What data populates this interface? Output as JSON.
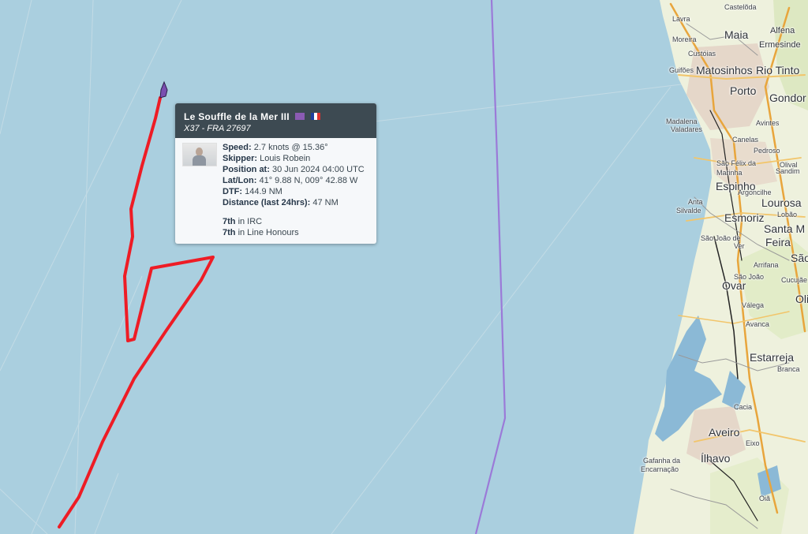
{
  "map": {
    "colors": {
      "sea": "#aacfdf",
      "land": "#eef0dd",
      "track": "#ee1c25",
      "course_line": "#9b7ad8",
      "boat": "#7a4fb0"
    },
    "places": [
      {
        "id": "castelo-da",
        "name": "Castelõda",
        "size": "small"
      },
      {
        "id": "lavra",
        "name": "Lavra",
        "size": "small"
      },
      {
        "id": "maia",
        "name": "Maia",
        "size": "big"
      },
      {
        "id": "alfena",
        "name": "Alfena",
        "size": "mid"
      },
      {
        "id": "moreira",
        "name": "Moreira",
        "size": "small"
      },
      {
        "id": "custoias",
        "name": "Custóias",
        "size": "small"
      },
      {
        "id": "ermesinde",
        "name": "Ermesinde",
        "size": "mid"
      },
      {
        "id": "guifoes",
        "name": "Guifões",
        "size": "small"
      },
      {
        "id": "matosinhos",
        "name": "Matosinhos",
        "size": "big"
      },
      {
        "id": "rio-tinto",
        "name": "Rio Tinto",
        "size": "big"
      },
      {
        "id": "porto",
        "name": "Porto",
        "size": "big"
      },
      {
        "id": "gondomar",
        "name": "Gondor",
        "size": "big"
      },
      {
        "id": "madalena",
        "name": "Madalena",
        "size": "small"
      },
      {
        "id": "valadares",
        "name": "Valadares",
        "size": "small"
      },
      {
        "id": "avintes",
        "name": "Avintes",
        "size": "small"
      },
      {
        "id": "canelas",
        "name": "Canelas",
        "size": "small"
      },
      {
        "id": "pedroso",
        "name": "Pedroso",
        "size": "small"
      },
      {
        "id": "sao-felix",
        "name": "São Félix da",
        "size": "small"
      },
      {
        "id": "marinha",
        "name": "Marinha",
        "size": "small"
      },
      {
        "id": "olival",
        "name": "Olival",
        "size": "small"
      },
      {
        "id": "sandim",
        "name": "Sandim",
        "size": "small"
      },
      {
        "id": "espinho",
        "name": "Espinho",
        "size": "big"
      },
      {
        "id": "argoncilhe",
        "name": "Argoncilhe",
        "size": "small"
      },
      {
        "id": "anta",
        "name": "Anta",
        "size": "small"
      },
      {
        "id": "lourosa",
        "name": "Lourosa",
        "size": "big"
      },
      {
        "id": "silvalde",
        "name": "Silvalde",
        "size": "small"
      },
      {
        "id": "esmoriz",
        "name": "Esmoriz",
        "size": "big"
      },
      {
        "id": "lobao",
        "name": "Lobão",
        "size": "small"
      },
      {
        "id": "santa-maria",
        "name": "Santa M",
        "size": "big"
      },
      {
        "id": "feira",
        "name": "Feira",
        "size": "big"
      },
      {
        "id": "sao-joao-ver",
        "name": "São João de",
        "size": "small"
      },
      {
        "id": "ver",
        "name": "Ver",
        "size": "small"
      },
      {
        "id": "arrifana",
        "name": "Arrifana",
        "size": "small"
      },
      {
        "id": "sao",
        "name": "São",
        "size": "big"
      },
      {
        "id": "sao-joao",
        "name": "São João",
        "size": "small"
      },
      {
        "id": "cucujaes",
        "name": "Cucujãe",
        "size": "small"
      },
      {
        "id": "ovar",
        "name": "Ovar",
        "size": "big"
      },
      {
        "id": "oli",
        "name": "Oli",
        "size": "big"
      },
      {
        "id": "valega",
        "name": "Válega",
        "size": "small"
      },
      {
        "id": "avanca",
        "name": "Avanca",
        "size": "small"
      },
      {
        "id": "estarreja",
        "name": "Estarreja",
        "size": "big"
      },
      {
        "id": "branca",
        "name": "Branca",
        "size": "small"
      },
      {
        "id": "cacia",
        "name": "Cacia",
        "size": "small"
      },
      {
        "id": "aveiro",
        "name": "Aveiro",
        "size": "big"
      },
      {
        "id": "eixo",
        "name": "Eixo",
        "size": "small"
      },
      {
        "id": "ilhavo",
        "name": "Ílhavo",
        "size": "big"
      },
      {
        "id": "gafanha",
        "name": "Gafanha da",
        "size": "small"
      },
      {
        "id": "encarnacao",
        "name": "Encarnação",
        "size": "small"
      },
      {
        "id": "oia",
        "name": "Oiã",
        "size": "small"
      }
    ]
  },
  "popup": {
    "boat_name": "Le Souffle de la Mer III",
    "boat_class": "X37 - FRA 27697",
    "speed_label": "Speed:",
    "speed_value": "2.7 knots @ 15.36°",
    "skipper_label": "Skipper:",
    "skipper_value": "Louis Robein",
    "position_label": "Position at:",
    "position_value": "30 Jun 2024 04:00 UTC",
    "latlon_label": "Lat/Lon:",
    "latlon_value": "41° 9.88 N, 009° 42.88 W",
    "dtf_label": "DTF:",
    "dtf_value": "144.9 NM",
    "distance_label": "Distance (last 24hrs):",
    "distance_value": "47 NM",
    "rank_irc_label": "7th",
    "rank_irc_value": "in IRC",
    "rank_lh_label": "7th",
    "rank_lh_value": "in Line Honours"
  }
}
